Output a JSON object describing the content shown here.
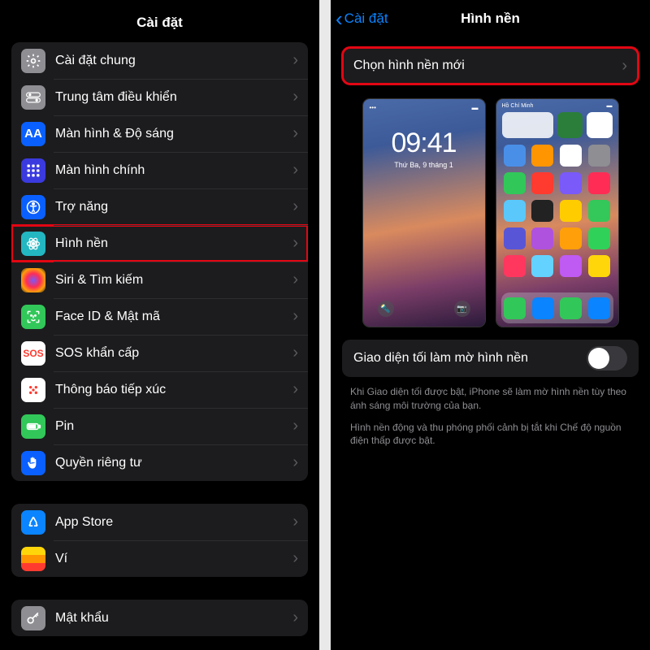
{
  "left": {
    "title": "Cài đặt",
    "group1": [
      {
        "icon": "general",
        "label": "Cài đặt chung"
      },
      {
        "icon": "control",
        "label": "Trung tâm điều khiển"
      },
      {
        "icon": "display",
        "label": "Màn hình & Độ sáng"
      },
      {
        "icon": "home",
        "label": "Màn hình chính"
      },
      {
        "icon": "access",
        "label": "Trợ năng"
      },
      {
        "icon": "wall",
        "label": "Hình nền",
        "highlight": true
      },
      {
        "icon": "siri",
        "label": "Siri & Tìm kiếm"
      },
      {
        "icon": "faceid",
        "label": "Face ID & Mật mã"
      },
      {
        "icon": "sos",
        "label": "SOS khẩn cấp"
      },
      {
        "icon": "exposure",
        "label": "Thông báo tiếp xúc"
      },
      {
        "icon": "battery",
        "label": "Pin"
      },
      {
        "icon": "privacy",
        "label": "Quyền riêng tư"
      }
    ],
    "group2": [
      {
        "icon": "appstore",
        "label": "App Store"
      },
      {
        "icon": "wallet",
        "label": "Ví"
      }
    ],
    "group3": [
      {
        "icon": "password",
        "label": "Mật khẩu"
      }
    ],
    "sos_text": "SOS",
    "display_text": "AA"
  },
  "right": {
    "back": "Cài đặt",
    "title": "Hình nền",
    "choose": "Chọn hình nền mới",
    "lock_time": "09:41",
    "lock_date": "Thứ Ba, 9 tháng 1",
    "home_status_left": "Hồ Chí Minh",
    "toggle_label": "Giao diện tối làm mờ hình nền",
    "footer1": "Khi Giao diện tối được bật, iPhone sẽ làm mờ hình nền tùy theo ánh sáng môi trường của bạn.",
    "footer2": "Hình nền động và thu phóng phối cảnh bị tắt khi Chế độ nguồn điện thấp được bật."
  },
  "app_colors": [
    "#4a8fe7",
    "#ff9500",
    "#fff",
    "#8e8e93",
    "#32c759",
    "#ff3b30",
    "#7a5af8",
    "#ff2d55",
    "#5ac8fa",
    "#222",
    "#ffcc00",
    "#34c759",
    "#5856d6",
    "#af52de",
    "#ff9f0a",
    "#30d158",
    "#ff375f",
    "#64d2ff",
    "#bf5af2",
    "#ffd60a"
  ]
}
